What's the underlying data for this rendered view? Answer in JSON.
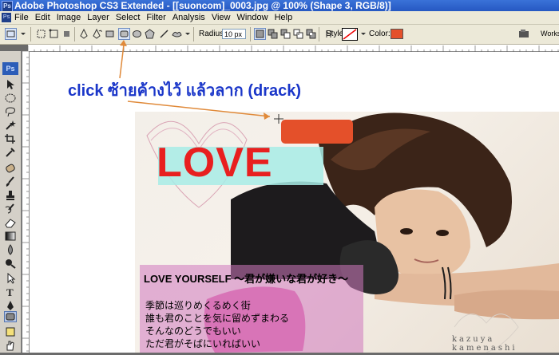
{
  "window": {
    "title": "Adobe Photoshop CS3 Extended - [[suoncom]_0003.jpg @ 100% (Shape 3, RGB/8)]"
  },
  "menu": [
    "File",
    "Edit",
    "Image",
    "Layer",
    "Select",
    "Filter",
    "Analysis",
    "View",
    "Window",
    "Help"
  ],
  "options": {
    "radius_label": "Radius:",
    "radius_value": "10 px",
    "style_label": "Style:",
    "color_label": "Color:",
    "workspace_label": "Works"
  },
  "toolbox": {
    "logo": "Ps"
  },
  "annotation": {
    "text": "click  ซ้ายค้างไว้  แล้วลาก  (drack)"
  },
  "image": {
    "love": "LOVE",
    "caption_title": "LOVE YOURSELF ～君が嫌いな君が好き～",
    "caption_lines": [
      "季節は巡りめくるめく街",
      "誰も君のことを気に留めずまわる",
      "そんなのどうでもいい",
      "ただ君がそばにいればいい"
    ],
    "signature": "kazuya kamenashi"
  },
  "colors": {
    "foreground": "#e4502a",
    "annotation": "#1a36c9",
    "love": "#e81f1f"
  }
}
